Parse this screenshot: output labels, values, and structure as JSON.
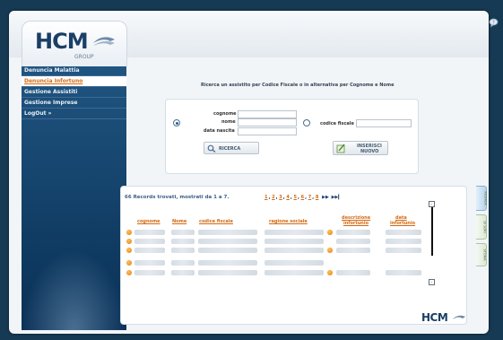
{
  "logo": {
    "text": "HCM",
    "group": "GROUP"
  },
  "sidebar": {
    "items": [
      {
        "label": "Denuncia Malattia"
      },
      {
        "label": "Denuncia Infortuno"
      },
      {
        "label": "Gestione Assistiti"
      },
      {
        "label": "Gestione Imprese"
      },
      {
        "label": "LogOut »"
      }
    ]
  },
  "search": {
    "heading": "Ricerca un assistito per Codice Fiscale o in alternativa per Cognome e Nome",
    "labels": {
      "cognome": "cognome",
      "nome": "nome",
      "data_nascita": "data nascita",
      "codice_fiscale": "codice fiscale"
    },
    "values": {
      "cognome": "",
      "nome": "",
      "data_nascita": "",
      "codice_fiscale": ""
    },
    "buttons": {
      "ricerca": "RICERCA",
      "inserisci_nuovo_line1": "INSERISCI",
      "inserisci_nuovo_line2": "NUOVO"
    }
  },
  "results": {
    "summary": "66 Records trovati, mostrati da 1 a 7.",
    "pages": [
      "1",
      "2",
      "3",
      "4",
      "5",
      "6",
      "7",
      "8"
    ],
    "columns": {
      "cognome": "cognome",
      "nome": "Nome",
      "codice_fiscale": "codice fiscale",
      "ragione_sociale": "ragione sociale",
      "descrizione_line1": "descrizione",
      "descrizione_line2": "infortunio",
      "data_line1": "data",
      "data_line2": "infortunio"
    }
  },
  "side_tabs": [
    "RICERCA",
    "DI SORI",
    "STORIA"
  ],
  "footer": {
    "logo": "HCM"
  },
  "colors": {
    "accent": "#d36a12",
    "sidebar": "#123f68",
    "background": "#163a54"
  }
}
